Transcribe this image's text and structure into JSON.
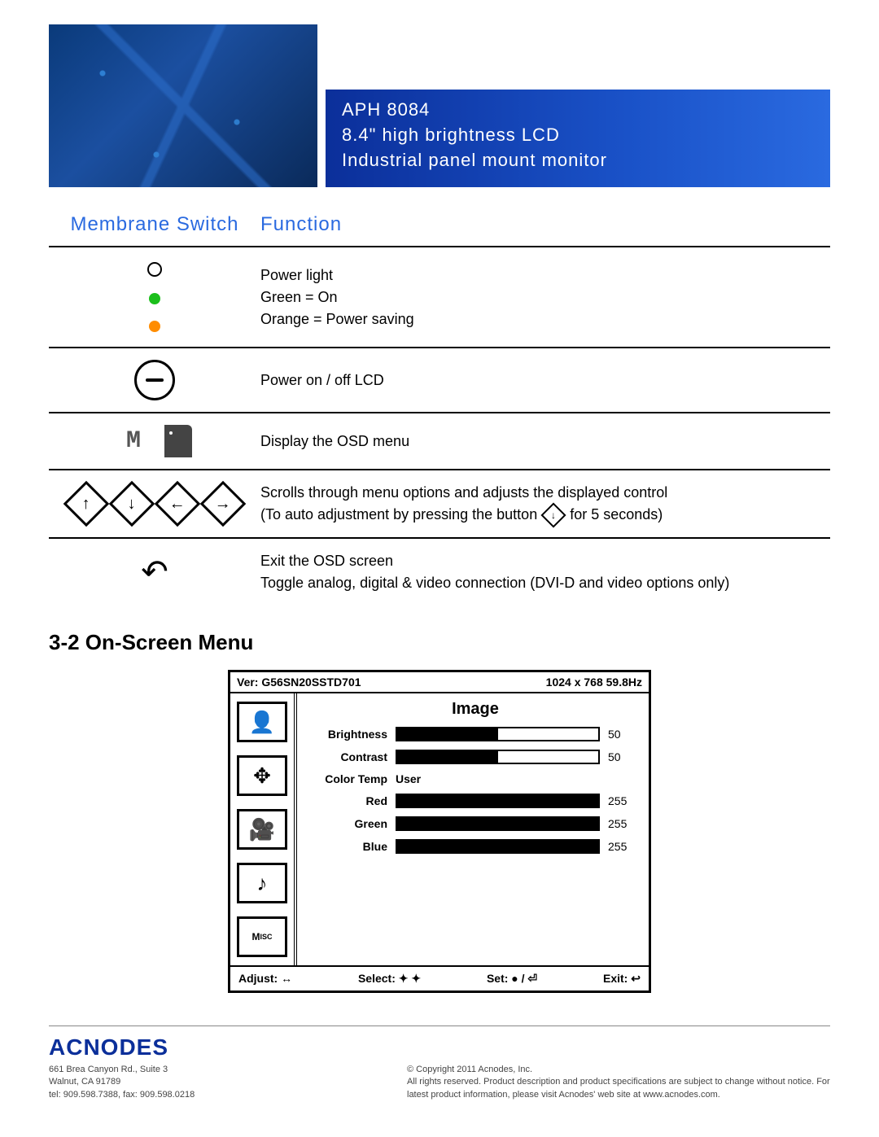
{
  "header": {
    "model": "APH 8084",
    "line2": "8.4\" high brightness LCD",
    "line3": "Industrial panel mount monitor"
  },
  "columns": {
    "icon": "Membrane Switch",
    "desc": "Function"
  },
  "rows": {
    "power_light": {
      "d1": "Power light",
      "d2": "Green = On",
      "d3": "Orange = Power saving"
    },
    "power_btn": {
      "d": "Power on / off LCD"
    },
    "menu_btn": {
      "d": "Display the OSD menu"
    },
    "arrows": {
      "d1": "Scrolls through menu options and adjusts the displayed control",
      "d2_a": "(To auto adjustment by pressing the button",
      "d2_b": " for 5 seconds)"
    },
    "exit": {
      "d1": "Exit the OSD screen",
      "d2": "Toggle analog, digital & video connection (DVI-D and video options only)"
    }
  },
  "section": "3-2  On-Screen Menu",
  "osd": {
    "ver": "Ver: G56SN20SSTD701",
    "mode": "1024 x 768  59.8Hz",
    "pane": "Image",
    "items": {
      "brightness": {
        "label": "Brightness",
        "value": 50,
        "max": 100
      },
      "contrast": {
        "label": "Contrast",
        "value": 50,
        "max": 100
      },
      "colortemp": {
        "label": "Color Temp",
        "text": "User"
      },
      "red": {
        "label": "Red",
        "value": 255,
        "max": 255
      },
      "green": {
        "label": "Green",
        "value": 255,
        "max": 255
      },
      "blue": {
        "label": "Blue",
        "value": 255,
        "max": 255
      }
    },
    "hints": {
      "adjust": "Adjust: ↔",
      "select": "Select: ✦ ✦",
      "set": "Set: ● / ⏎",
      "exit": "Exit: ↩"
    }
  },
  "footer": {
    "brand": "ACNODES",
    "addr1": "661 Brea Canyon Rd., Suite 3",
    "addr2": "Walnut, CA 91789",
    "addr3": "tel: 909.598.7388, fax: 909.598.0218",
    "copy": "© Copyright 2011 Acnodes, Inc.",
    "legal": "All rights reserved. Product description and product specifications are subject to change without notice. For latest product information, please visit Acnodes' web site at www.acnodes.com."
  }
}
